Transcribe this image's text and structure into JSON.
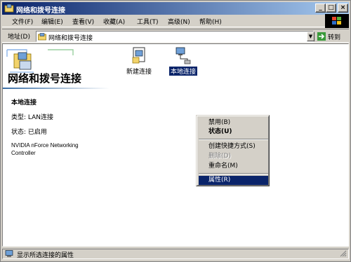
{
  "window": {
    "title": "网络和拨号连接",
    "controls": {
      "minimize": "_",
      "maximize": "□",
      "close": "×"
    }
  },
  "menubar": {
    "items": [
      {
        "label": "文件(F)"
      },
      {
        "label": "编辑(E)"
      },
      {
        "label": "查看(V)"
      },
      {
        "label": "收藏(A)"
      },
      {
        "label": "工具(T)"
      },
      {
        "label": "高级(N)"
      },
      {
        "label": "帮助(H)"
      }
    ]
  },
  "address": {
    "label": "地址(D)",
    "value": "网络和拨号连接",
    "go_label": "转到"
  },
  "left_panel": {
    "title": "网络和拨号连接",
    "selected_name": "本地连接",
    "type_line": "类型: LAN连接",
    "status_line": "状态: 已启用",
    "device": "NVIDIA nForce Networking Controller"
  },
  "items": [
    {
      "label": "新建连接",
      "icon": "new-connection-icon"
    },
    {
      "label": "本地连接",
      "icon": "local-area-connection-icon",
      "selected": true
    }
  ],
  "context_menu": {
    "items": [
      {
        "label": "禁用(B)",
        "style": "normal"
      },
      {
        "label": "状态(U)",
        "style": "bold"
      },
      {
        "label": "创建快捷方式(S)",
        "style": "normal"
      },
      {
        "label": "删除(D)",
        "style": "disabled"
      },
      {
        "label": "重命名(M)",
        "style": "normal"
      },
      {
        "label": "属性(R)",
        "style": "highlighted"
      }
    ]
  },
  "statusbar": {
    "text": "显示所选连接的属性"
  },
  "colors": {
    "title_active": "#0a246a",
    "title_gradient_end": "#a6caf0",
    "face": "#d4d0c8",
    "selection": "#0a246a"
  }
}
